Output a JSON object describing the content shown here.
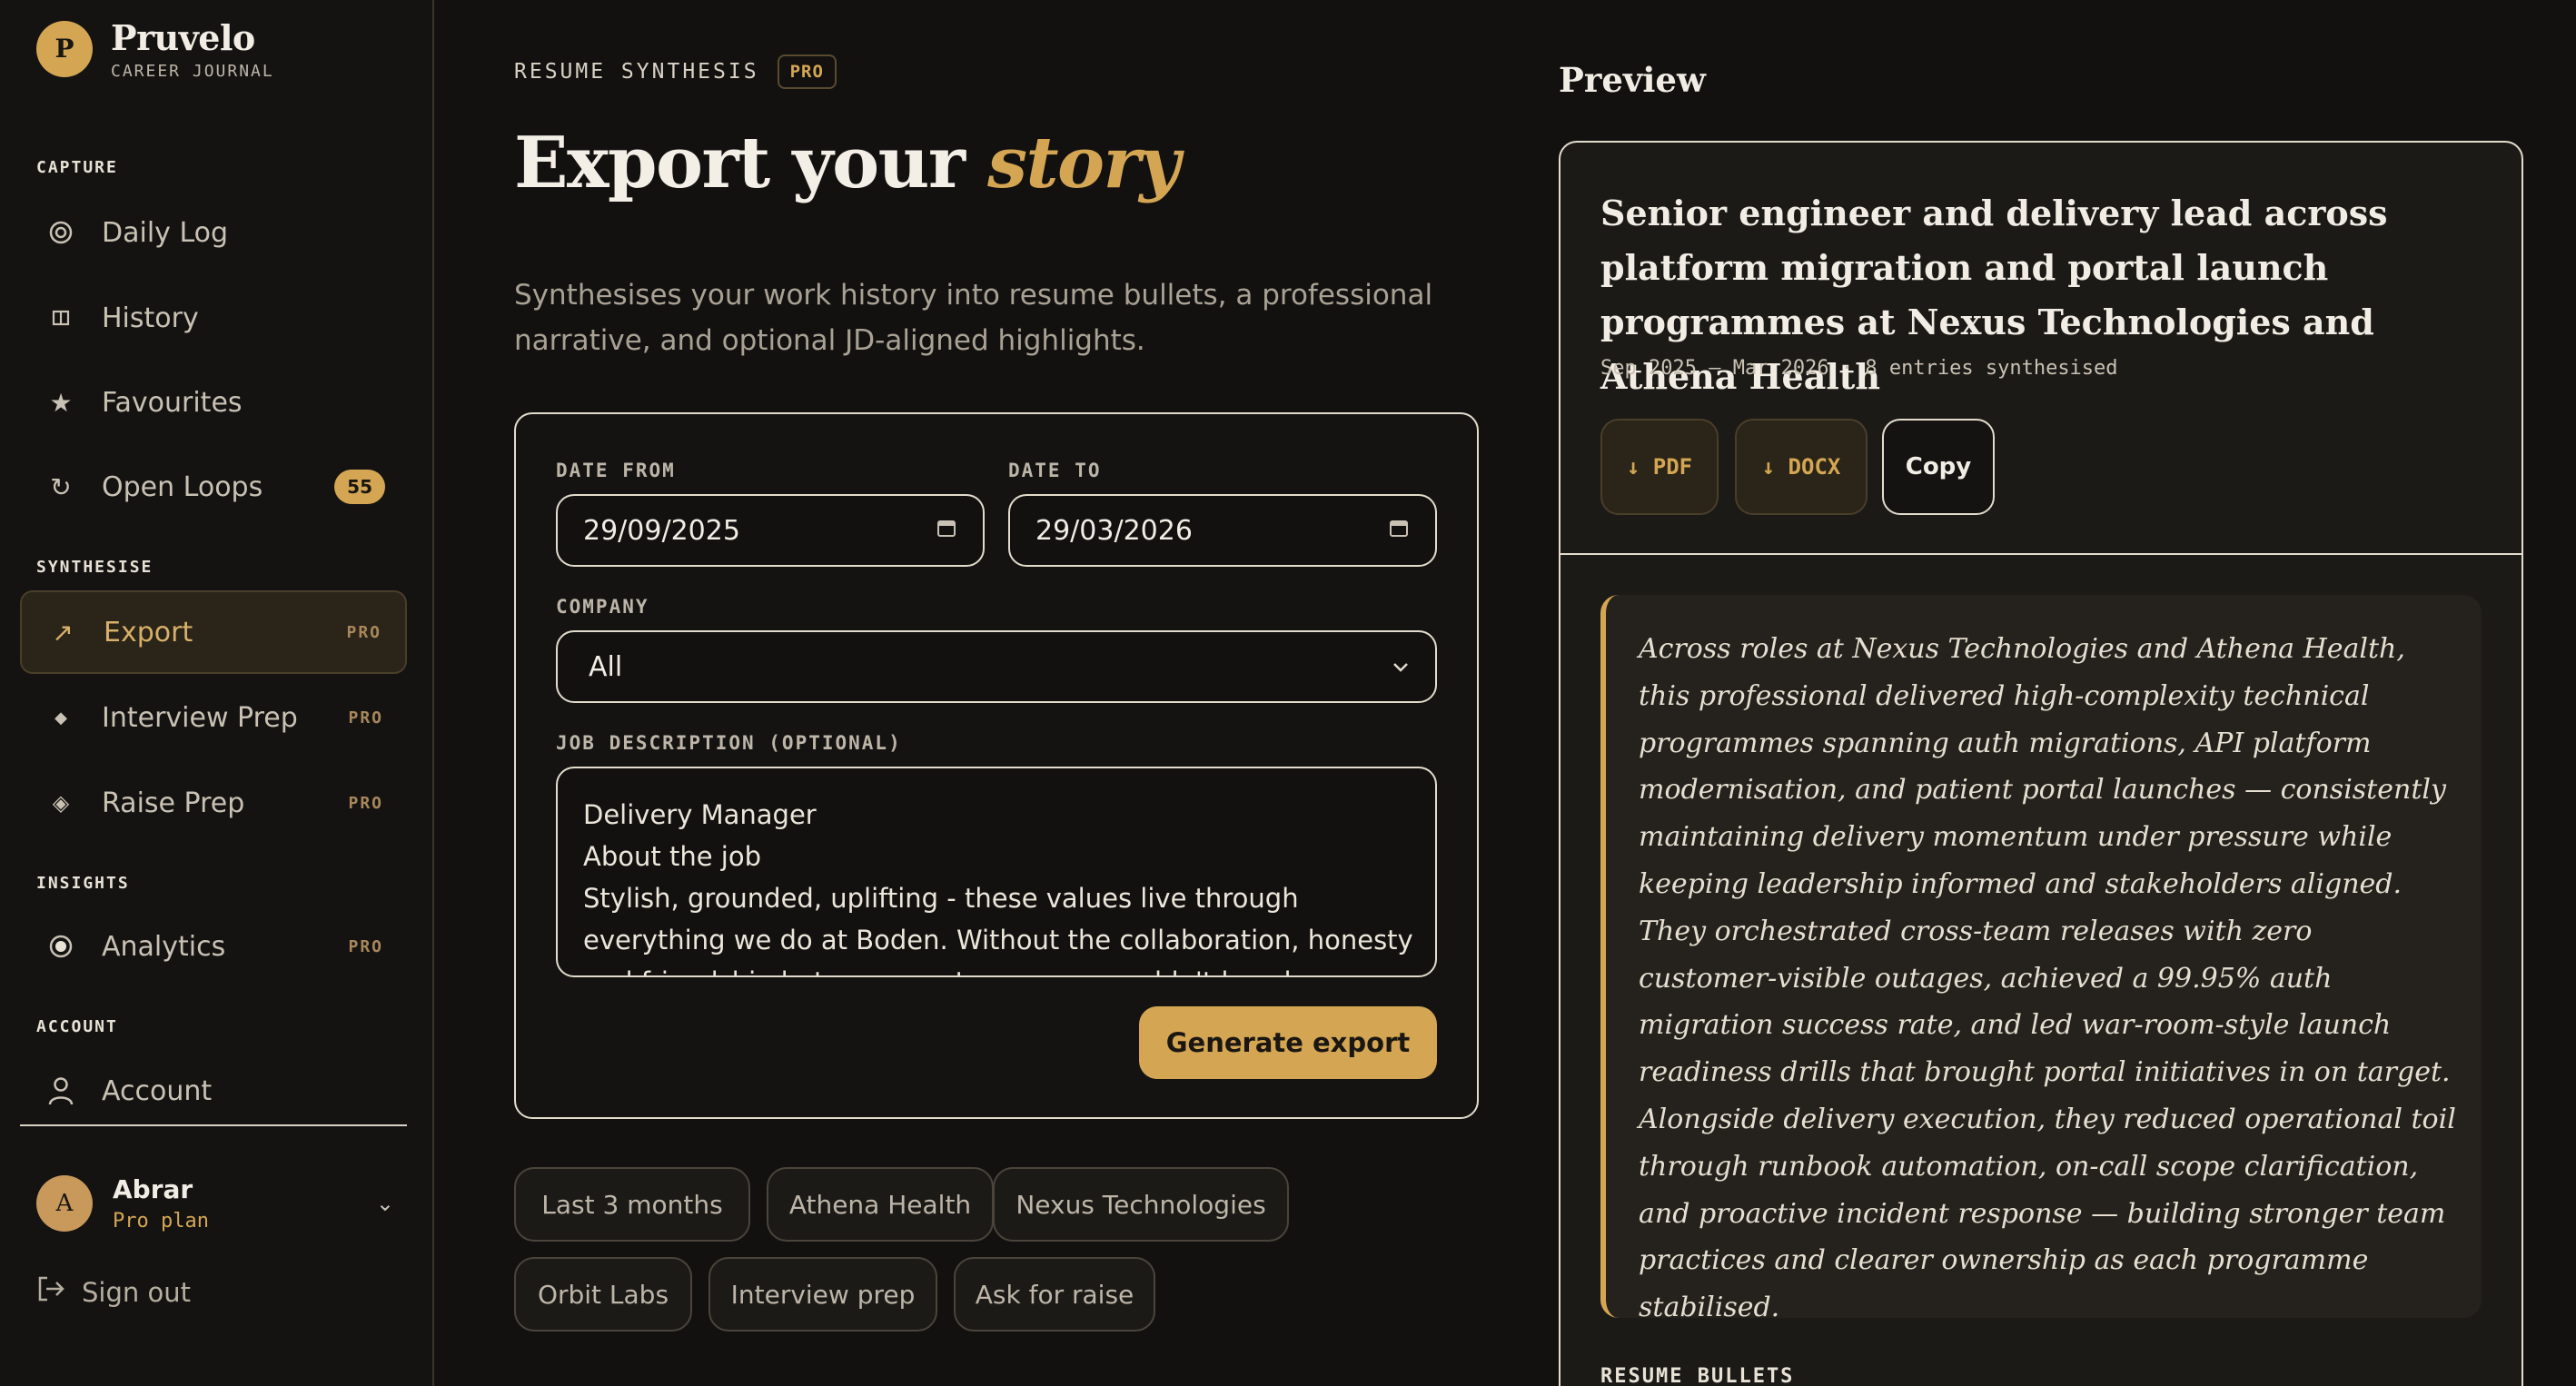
{
  "brand": {
    "logo_letter": "P",
    "name": "Pruvelo",
    "subtitle": "CAREER JOURNAL"
  },
  "sidebar": {
    "sections": {
      "capture": "CAPTURE",
      "synthesise": "SYNTHESISE",
      "insights": "INSIGHTS",
      "account": "ACCOUNT"
    },
    "items": [
      {
        "label": "Daily Log",
        "icon": "target-icon"
      },
      {
        "label": "History",
        "icon": "book-icon"
      },
      {
        "label": "Favourites",
        "icon": "star-icon"
      },
      {
        "label": "Open Loops",
        "icon": "refresh-icon",
        "badge": "55"
      },
      {
        "label": "Export",
        "icon": "arrow-up-right-icon",
        "tag": "PRO",
        "active": true
      },
      {
        "label": "Interview Prep",
        "icon": "diamond-icon",
        "tag": "PRO"
      },
      {
        "label": "Raise Prep",
        "icon": "diamond-outline-icon",
        "tag": "PRO"
      },
      {
        "label": "Analytics",
        "icon": "radio-icon",
        "tag": "PRO"
      },
      {
        "label": "Account",
        "icon": "user-icon"
      }
    ],
    "user": {
      "avatar_letter": "A",
      "name": "Abrar",
      "plan": "Pro plan"
    },
    "sign_out": "Sign out"
  },
  "header": {
    "eyebrow": "RESUME SYNTHESIS",
    "eyebrow_tag": "PRO",
    "title_main": "Export your",
    "title_accent": "story",
    "description": "Synthesises your work history into resume bullets, a professional narrative, and optional JD-aligned highlights."
  },
  "form": {
    "date_from_label": "DATE FROM",
    "date_from_value": "29/09/2025",
    "date_to_label": "DATE TO",
    "date_to_value": "29/03/2026",
    "company_label": "COMPANY",
    "company_value": "All",
    "jd_label": "JOB DESCRIPTION (OPTIONAL)",
    "jd_lines": [
      "Delivery Manager",
      "About the job",
      "Stylish, grounded, uplifting - these values live through",
      "everything we do at Boden. Without the collaboration, honesty",
      "and friendship between our teams, we wouldn't be where we"
    ],
    "generate_label": "Generate export"
  },
  "chips": [
    "Last 3 months",
    "Athena Health",
    "Nexus Technologies",
    "Orbit Labs",
    "Interview prep",
    "Ask for raise"
  ],
  "preview": {
    "heading": "Preview",
    "title": "Senior engineer and delivery lead across platform migration and portal launch programmes at Nexus Technologies and Athena Health",
    "meta": "Sep 2025 – Mar 2026 · 8 entries synthesised",
    "pdf_label": "↓ PDF",
    "docx_label": "↓ DOCX",
    "copy_label": "Copy",
    "narrative": "Across roles at Nexus Technologies and Athena Health, this professional delivered high-complexity technical programmes spanning auth migrations, API platform modernisation, and patient portal launches — consistently maintaining delivery momentum under pressure while keeping leadership informed and stakeholders aligned. They orchestrated cross-team releases with zero customer-visible outages, achieved a 99.95% auth migration success rate, and led war-room-style launch readiness drills that brought portal initiatives in on target. Alongside delivery execution, they reduced operational toil through runbook automation, on-call scope clarification, and proactive incident response — building stronger team practices and clearer ownership as each programme stabilised.",
    "bullets_label": "RESUME BULLETS"
  },
  "colors": {
    "accent": "#d4a653",
    "background": "#121110",
    "surface": "#1c1a17"
  }
}
